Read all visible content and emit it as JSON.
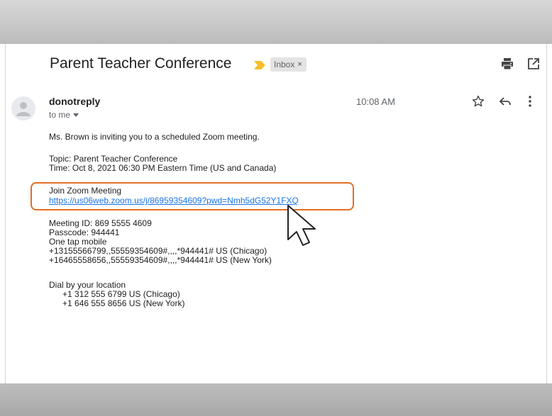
{
  "email": {
    "subject": "Parent Teacher Conference",
    "label": "Inbox",
    "label_remove": "×",
    "sender": "donotreply",
    "recipient": "to me",
    "time": "10:08 AM",
    "body": {
      "intro": "Ms. Brown is inviting you to a scheduled Zoom meeting.",
      "topic": "Topic: Parent Teacher Conference",
      "meeting_time": "Time: Oct 8, 2021 06:30 PM Eastern Time (US and Canada)",
      "join_heading": "Join Zoom Meeting",
      "join_link": "https://us06web.zoom.us/j/86959354609?pwd=Nmh5dG52Y1FXQ",
      "meeting_id": "Meeting ID: 869 5555 4609",
      "passcode": "Passcode: 944441",
      "one_tap": "One tap mobile",
      "tap_1": "+13155566799,,55559354609#,,,,*944441# US (Chicago)",
      "tap_2": "+16465558656,,55559354609#,,,,*944441# US (New York)",
      "dial_heading": "Dial by your location",
      "dial_1": "+1 312 555 6799 US (Chicago)",
      "dial_2": "+1 646 555 8656 US (New York)"
    }
  },
  "icons": [
    "importance-marker-icon",
    "print-icon",
    "open-in-new-window-icon",
    "avatar-icon",
    "dropdown-arrow-icon",
    "star-icon",
    "reply-icon",
    "more-vert-icon",
    "mouse-pointer-icon"
  ],
  "colors": {
    "accent_highlight": "#e26f22",
    "link": "#1a73e8",
    "importance": "#f6bf26"
  }
}
